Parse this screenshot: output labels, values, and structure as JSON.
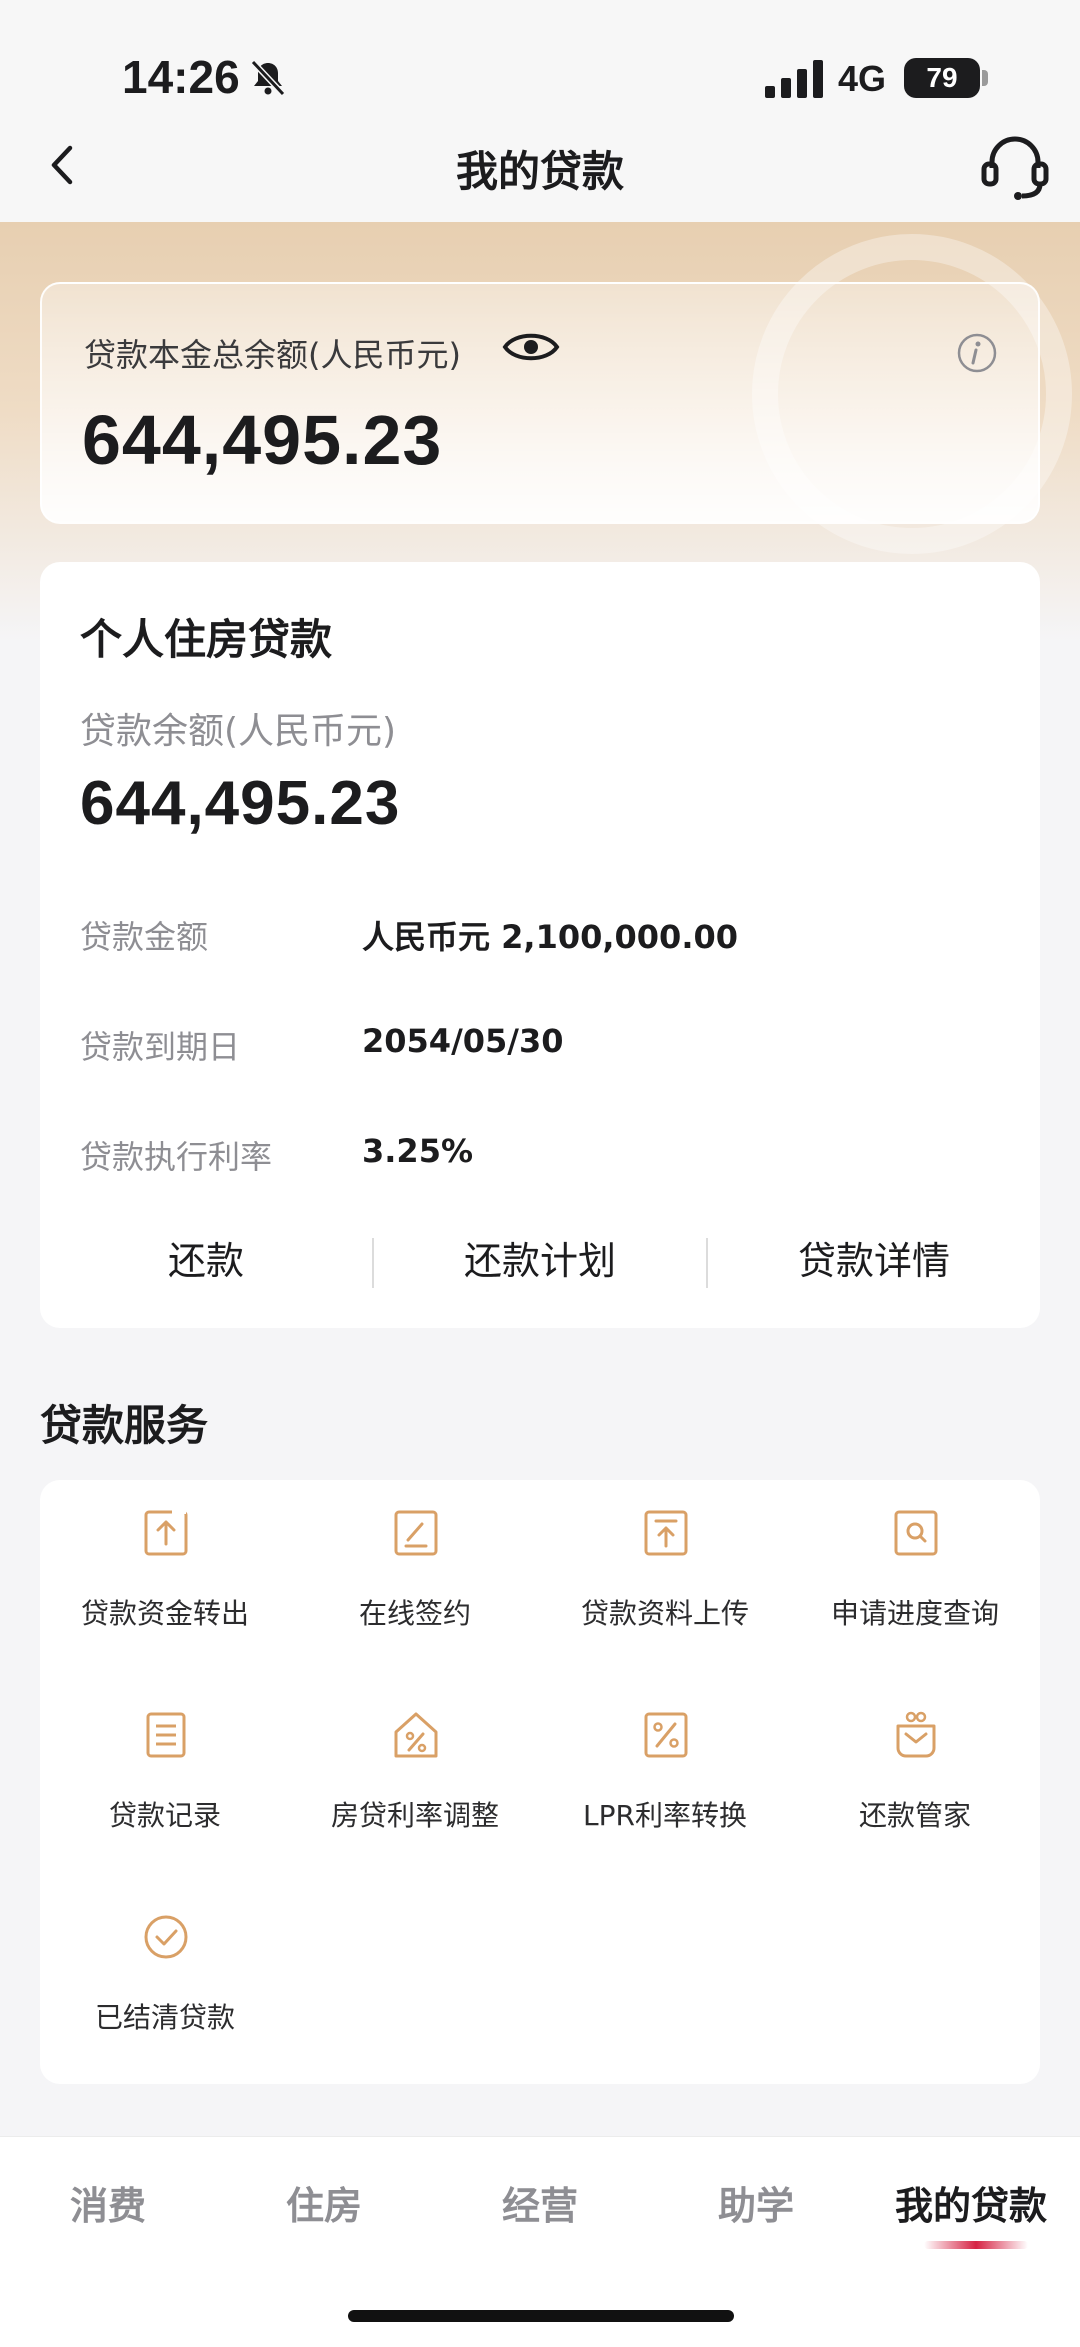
{
  "status_bar": {
    "time": "14:26",
    "network": "4G",
    "battery": "79"
  },
  "nav": {
    "title": "我的贷款"
  },
  "summary": {
    "label": "贷款本金总余额(人民币元)",
    "amount": "644,495.23"
  },
  "loan": {
    "title": "个人住房贷款",
    "balance_label": "贷款余额(人民币元)",
    "balance": "644,495.23",
    "details": [
      {
        "label": "贷款金额",
        "value": "人民币元 2,100,000.00"
      },
      {
        "label": "贷款到期日",
        "value": "2054/05/30"
      },
      {
        "label": "贷款执行利率",
        "value": "3.25%"
      }
    ],
    "actions": [
      "还款",
      "还款计划",
      "贷款详情"
    ]
  },
  "services": {
    "title": "贷款服务",
    "items": [
      {
        "label": "贷款资金转出",
        "icon": "transfer-out-icon"
      },
      {
        "label": "在线签约",
        "icon": "sign-icon"
      },
      {
        "label": "贷款资料上传",
        "icon": "upload-icon"
      },
      {
        "label": "申请进度查询",
        "icon": "search-doc-icon"
      },
      {
        "label": "贷款记录",
        "icon": "record-icon"
      },
      {
        "label": "房贷利率调整",
        "icon": "house-rate-icon"
      },
      {
        "label": "LPR利率转换",
        "icon": "percent-icon"
      },
      {
        "label": "还款管家",
        "icon": "butler-icon"
      },
      {
        "label": "已结清贷款",
        "icon": "check-circle-icon"
      }
    ]
  },
  "tabs": [
    "消费",
    "住房",
    "经营",
    "助学",
    "我的贷款"
  ],
  "active_tab": "我的贷款",
  "colors": {
    "accent": "#d9a066",
    "active_indicator": "#d62344",
    "header_gold": "#e7cfb1"
  }
}
